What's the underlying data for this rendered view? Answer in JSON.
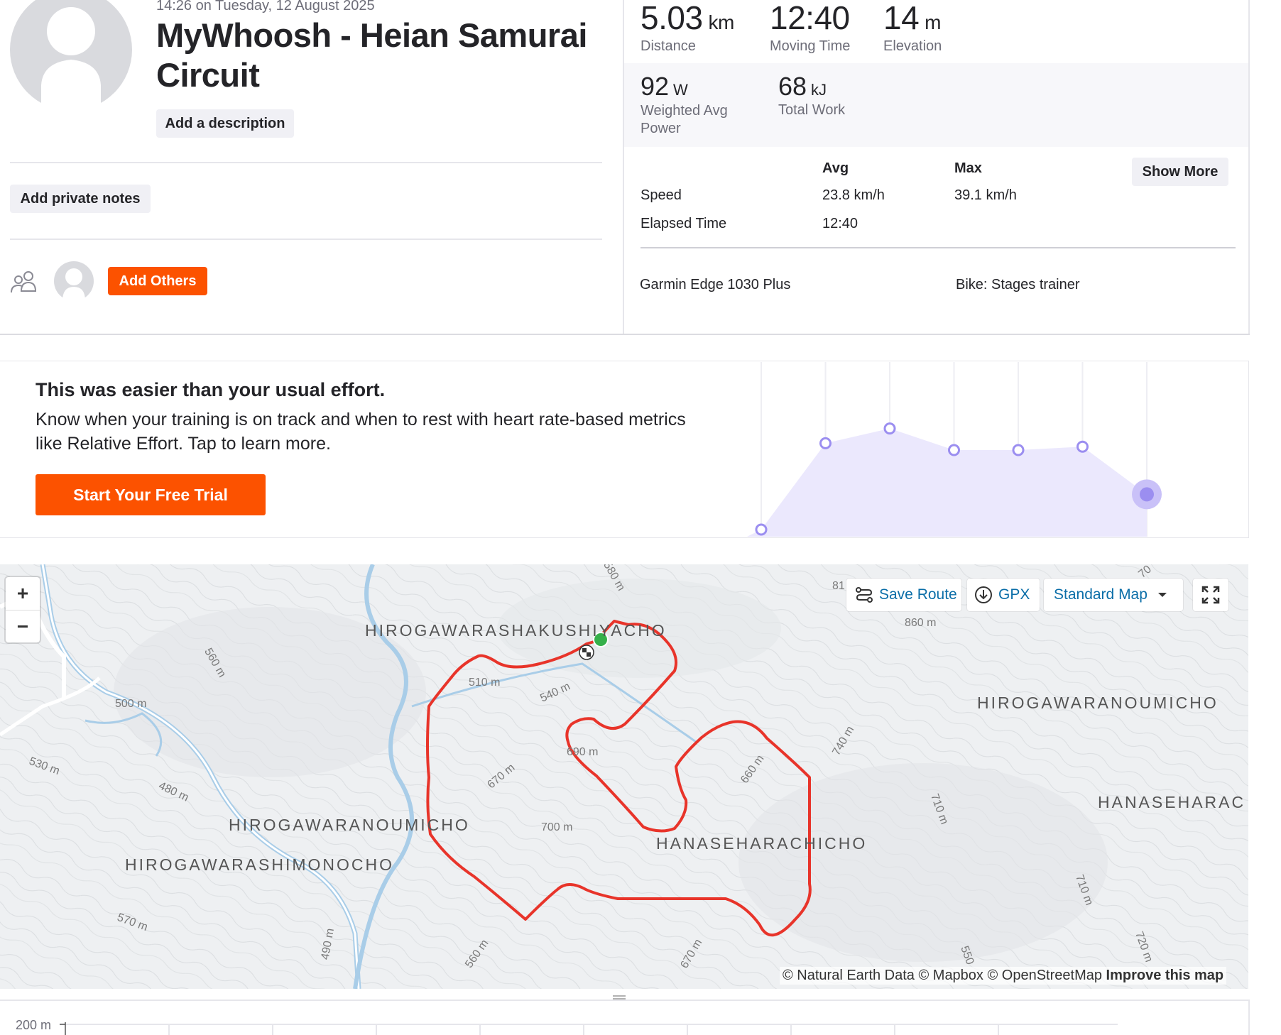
{
  "activity": {
    "timestamp": "14:26 on Tuesday, 12 August 2025",
    "title": "MyWhoosh - Heian Samurai Circuit",
    "add_description": "Add a description",
    "add_private_notes": "Add private notes",
    "add_others": "Add Others"
  },
  "stats": {
    "distance": {
      "value": "5.03",
      "unit": "km",
      "label": "Distance"
    },
    "moving_time": {
      "value": "12:40",
      "label": "Moving Time"
    },
    "elevation": {
      "value": "14",
      "unit": "m",
      "label": "Elevation"
    },
    "weighted_power": {
      "value": "92",
      "unit": "W",
      "label": "Weighted Avg Power"
    },
    "total_work": {
      "value": "68",
      "unit": "kJ",
      "label": "Total Work"
    },
    "table": {
      "avg_header": "Avg",
      "max_header": "Max",
      "rows": [
        {
          "label": "Speed",
          "avg": "23.8 km/h",
          "max": "39.1 km/h"
        },
        {
          "label": "Elapsed Time",
          "avg": "12:40",
          "max": ""
        }
      ]
    },
    "show_more": "Show More",
    "device": "Garmin Edge 1030 Plus",
    "bike": "Bike: Stages trainer"
  },
  "upsell": {
    "title": "This was easier than your usual effort.",
    "body": "Know when your training is on track and when to rest with heart rate-based metrics like Relative Effort. Tap to learn more.",
    "button": "Start Your Free Trial",
    "chart_values": [
      0,
      0.76,
      0.89,
      0.7,
      0.7,
      0.73,
      0.31
    ],
    "accent": "#9b8ef0",
    "fill": "#ebe8fd"
  },
  "map": {
    "zoom_in": "+",
    "zoom_out": "−",
    "save_route": "Save Route",
    "gpx": "GPX",
    "map_style": "Standard Map",
    "attribution": "© Natural Earth Data © Mapbox © OpenStreetMap",
    "improve": "Improve this map",
    "place_labels": [
      "HIROGAWARASHAKUSHIYACHO",
      "HIROGAWARANOUMICHO",
      "HANASEHARAC",
      "HIROGAWARANOUMICHO",
      "HANASEHARACHICHO",
      "HIROGAWARASHIMONOCHO"
    ],
    "contour_labels": [
      "580 m",
      "81",
      "860 m",
      "560 m",
      "500 m",
      "510 m",
      "540 m",
      "740 m",
      "530 m",
      "480 m",
      "670 m",
      "690 m",
      "660 m",
      "700 m",
      "710 m",
      "710 m",
      "570 m",
      "490 m",
      "560 m",
      "670 m",
      "550",
      "720 m",
      "70"
    ],
    "route_color": "#e8342a",
    "start_color": "#35b04a"
  },
  "elevation_chart": {
    "y_label": "200 m"
  }
}
